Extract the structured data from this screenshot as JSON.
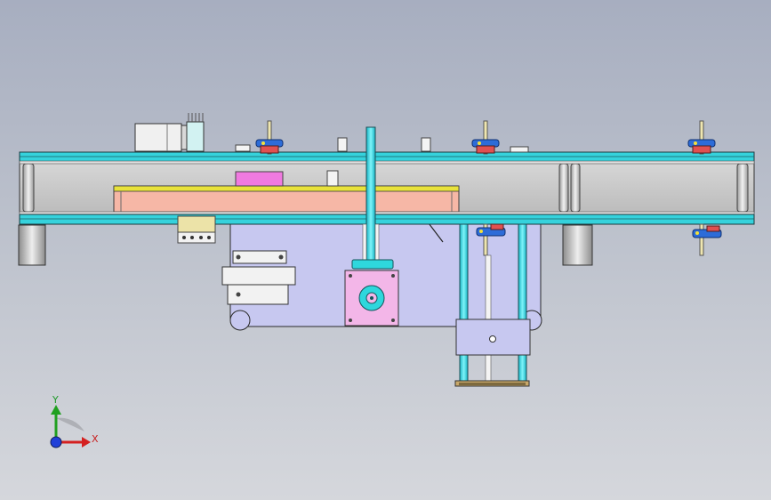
{
  "view": {
    "type": "cad-orthographic-view",
    "colors": {
      "background_top": "#a7aec0",
      "background_bottom": "#d5d7dc",
      "frame_rail": "#35d2dc",
      "belt": "#bfbfbf",
      "carrier": "#f6b7a6",
      "carrier_edge": "#e8e23b",
      "cabinet": "#c7c8f0",
      "motor_flange": "#f3b6e8",
      "column": "#38e0e8",
      "axis_x": "#d42020",
      "axis_y": "#20a020",
      "axis_z": "#2040d8"
    }
  },
  "triad": {
    "icon": "xyz-axis-triad-icon",
    "x_label": "X",
    "y_label": "Y"
  }
}
